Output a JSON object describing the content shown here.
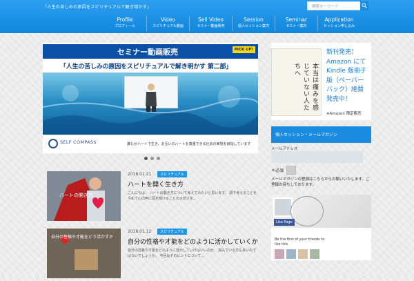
{
  "header": {
    "tagline": "「人生の苦しみの原因をスピリチュアルで解き明かす」",
    "search_placeholder": "検索キーワード",
    "nav": [
      {
        "en": "Profile",
        "ja": "プロフィール"
      },
      {
        "en": "Video",
        "ja": "スピリチュアル動画"
      },
      {
        "en": "Sell Video",
        "ja": "セミナー動画販売"
      },
      {
        "en": "Session",
        "ja": "個人セッション案内"
      },
      {
        "en": "Seminar",
        "ja": "セミナー案内"
      },
      {
        "en": "Application",
        "ja": "セッション申し込み"
      }
    ]
  },
  "hero": {
    "banner_title": "セミナー動画販売",
    "badge": "PICK UP!",
    "subtitle": "「人生の苦しみの原因をスピリチュアルで解き明かす 第二部」",
    "brand": "SELF COMPASS",
    "slogan": "誰もがハートで生き、お互いのハートを尊重できる社会の実現を目指しています"
  },
  "posts": [
    {
      "date": "2018.01.21",
      "category": "スピリチュアル",
      "title": "ハートを開く生き方",
      "thumb_text": "ハートの開き方",
      "excerpt": "こんにちは、 ハートの開き方について考えてみたいと思います。 頭で考えることをやめて心の声に耳を傾けることの大切さを..."
    },
    {
      "date": "2018.01.12",
      "category": "スピリチュアル",
      "title": "自分の性格や才能をどのように活かしていくか",
      "thumb_text": "自分の性格や才能をどう活かすか",
      "excerpt": "自分の性格や才能をどのように活かしていけばいいのか、 悩んでいる方も多いのではないでしょうか。 今回はそのヒントについて..."
    }
  ],
  "sidebar": {
    "book_cover": "本当は痛みを感じていない人たちへ",
    "book_text": "新刊発売！Amazon にて Kindle 版冊子版（ペーパーバック）絶賛発売中！",
    "book_note": "※Amazon 限定販売",
    "widget_title": "個人セッション・メールマガジン",
    "widget_label": "メールアドレス",
    "widget_line1": "＊必須",
    "widget_line2": "メールマガジンの登録はこちらからお願いいたします。ご登録お待ちしております。",
    "fb_like": "Like Page",
    "fb_text": "Be the first of your friends to like this"
  },
  "colors": {
    "header": "#2196e3",
    "accent": "#1a8be0",
    "banner": "#0b4fa6"
  }
}
